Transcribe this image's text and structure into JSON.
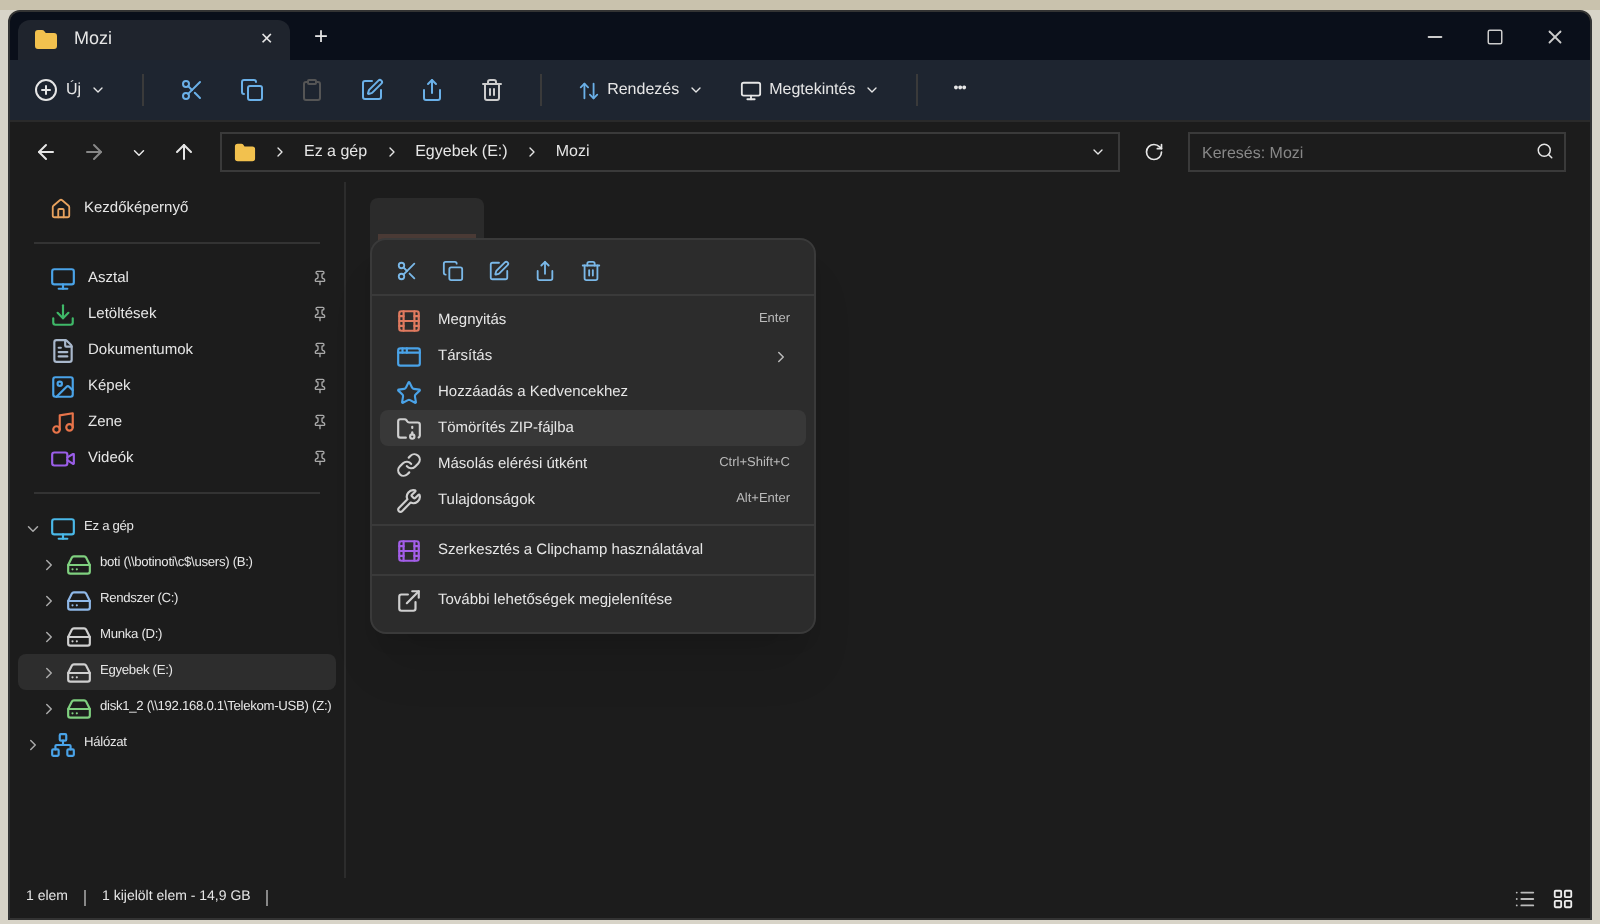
{
  "tab": {
    "title": "Mozi",
    "close": "✕",
    "new": "+"
  },
  "toolbar": {
    "new": "Új",
    "sort": "Rendezés",
    "view": "Megtekintés",
    "more": "•••"
  },
  "address": {
    "crumbs": [
      "Ez a gép",
      "Egyebek (E:)",
      "Mozi"
    ]
  },
  "search": {
    "placeholder": "Keresés: Mozi"
  },
  "sidebar": {
    "home": "Kezdőképernyő",
    "pinned": [
      {
        "label": "Asztal"
      },
      {
        "label": "Letöltések"
      },
      {
        "label": "Dokumentumok"
      },
      {
        "label": "Képek"
      },
      {
        "label": "Zene"
      },
      {
        "label": "Videók"
      }
    ],
    "tree": [
      {
        "label": "Ez a gép",
        "expanded": true,
        "selected": false,
        "children": [
          {
            "label": "boti (\\\\botinoti\\c$\\users) (B:)",
            "expanded": false,
            "selected": false
          },
          {
            "label": "Rendszer (C:)",
            "expanded": false,
            "selected": false
          },
          {
            "label": "Munka (D:)",
            "expanded": false,
            "selected": false
          },
          {
            "label": "Egyebek (E:)",
            "expanded": false,
            "selected": true
          },
          {
            "label": "disk1_2 (\\\\192.168.0.1\\Telekom-USB) (Z:)",
            "expanded": false,
            "selected": false
          }
        ]
      },
      {
        "label": "Hálózat",
        "expanded": false,
        "selected": false
      }
    ]
  },
  "menu": {
    "groups": [
      [
        {
          "label": "Megnyitás",
          "shortcut": "Enter",
          "submenu": false,
          "selected": false
        },
        {
          "label": "Társítás",
          "submenu": true,
          "selected": false
        },
        {
          "label": "Hozzáadás a Kedvencekhez",
          "submenu": false,
          "selected": false
        },
        {
          "label": "Tömörítés ZIP-fájlba",
          "submenu": false,
          "selected": true
        },
        {
          "label": "Másolás elérési útként",
          "shortcut": "Ctrl+Shift+C",
          "submenu": false,
          "selected": false
        },
        {
          "label": "Tulajdonságok",
          "shortcut": "Alt+Enter",
          "submenu": false,
          "selected": false
        }
      ],
      [
        {
          "label": "Szerkesztés a Clipchamp használatával",
          "submenu": false,
          "selected": false
        }
      ],
      [
        {
          "label": "További lehetőségek megjelenítése",
          "submenu": false,
          "selected": false
        }
      ]
    ]
  },
  "status": [
    "1 elem",
    "1 kijelölt elem - 14,9 GB"
  ]
}
